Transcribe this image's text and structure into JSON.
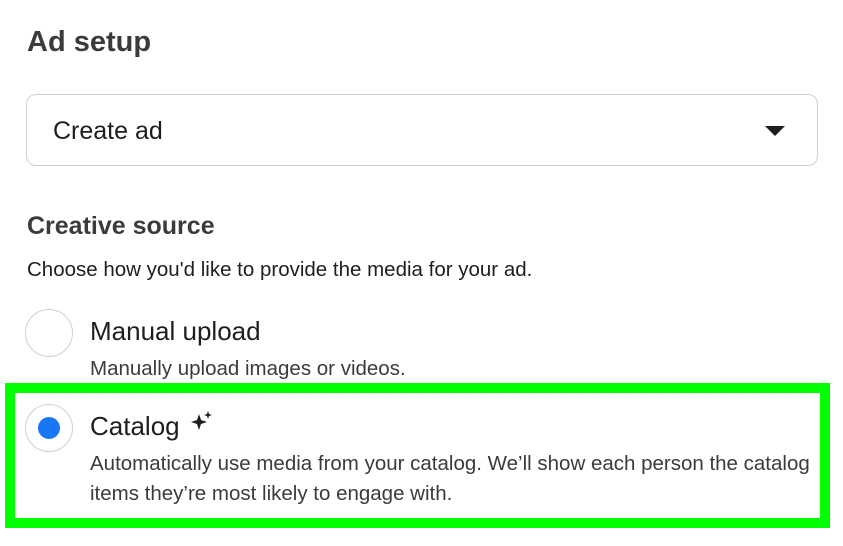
{
  "ad_setup": {
    "title": "Ad setup",
    "select": {
      "value": "Create ad"
    }
  },
  "creative_source": {
    "title": "Creative source",
    "helper": "Choose how you'd like to provide the media for your ad.",
    "options": [
      {
        "label": "Manual upload",
        "description": "Manually upload images or videos.",
        "selected": false
      },
      {
        "label": "Catalog",
        "description": "Automatically use media from your catalog. We’ll show each person the catalog items they’re most likely to engage with.",
        "selected": true,
        "icon": "sparkle-icon"
      }
    ]
  },
  "colors": {
    "accent": "#1877f2",
    "highlight": "#00ff00",
    "border": "#ccd0d5"
  }
}
